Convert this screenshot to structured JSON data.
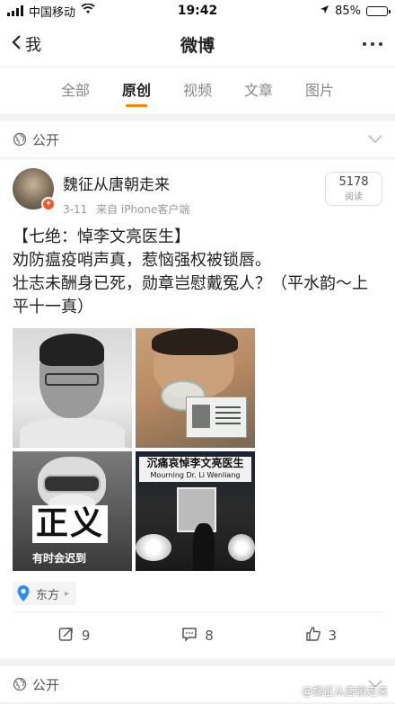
{
  "status_bar": {
    "carrier": "中国移动",
    "time": "19:42",
    "battery_percent": "85%",
    "battery_level": 0.85
  },
  "nav": {
    "back_label": "我",
    "title": "微博"
  },
  "tabs": [
    {
      "label": "全部",
      "active": false
    },
    {
      "label": "原创",
      "active": true
    },
    {
      "label": "视频",
      "active": false
    },
    {
      "label": "文章",
      "active": false
    },
    {
      "label": "图片",
      "active": false
    }
  ],
  "visibility_label": "公开",
  "post": {
    "username": "魏征从唐朝走来",
    "date": "3-11",
    "source_prefix": "来自",
    "source": "iPhone客户端",
    "read_count": "5178",
    "read_label": "阅读",
    "text_lines": [
      "【七绝：悼李文亮医生】",
      "劝防瘟疫哨声真，惹恼强权被锁唇。",
      "壮志未酬身已死，勋章岂慰戴冤人？（平水韵～上平十一真）"
    ],
    "photo3_big_text": "正义",
    "photo3_small_text": "有时会迟到",
    "photo4_banner_line1": "沉痛哀悼李文亮医生",
    "photo4_banner_line2": "Mourning Dr. Li Wenliang",
    "location": "东方",
    "actions": {
      "repost_count": "9",
      "comment_count": "8",
      "like_count": "3"
    }
  },
  "next_visibility_label": "公开",
  "watermark": "@魏征从唐朝走来",
  "colors": {
    "accent": "#ff8200",
    "verified_badge": "#f05a28",
    "location_pin": "#2f8cf0"
  }
}
